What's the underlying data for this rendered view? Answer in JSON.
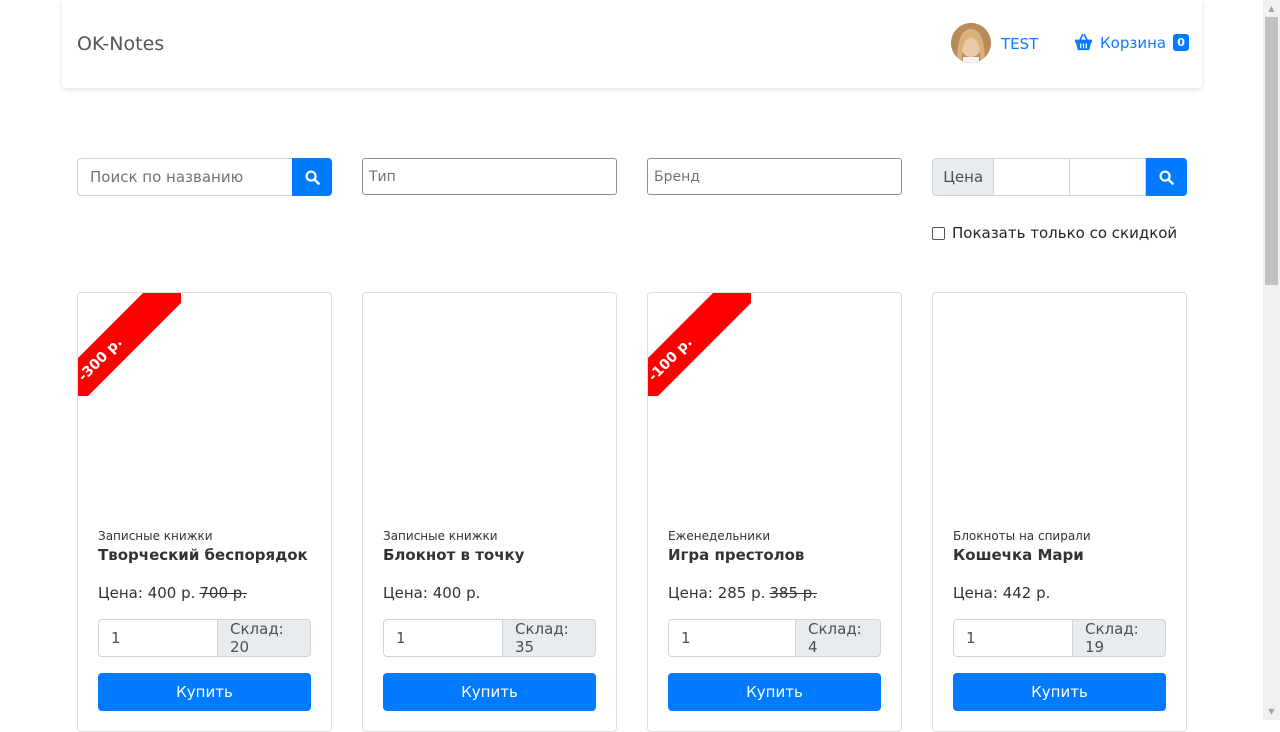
{
  "navbar": {
    "brand": "OK-Notes",
    "user": "TEST",
    "cart_label": "Корзина",
    "cart_count": "0"
  },
  "filters": {
    "search_placeholder": "Поиск по названию",
    "type_placeholder": "Тип",
    "brand_placeholder": "Бренд",
    "price_label": "Цена",
    "discount_label": "Показать только со скидкой"
  },
  "products": [
    {
      "discount": "-300 р.",
      "category": "Записные книжки",
      "title": "Творческий беспорядок",
      "price_prefix": "Цена: 400 р.",
      "old_price": "700 р.",
      "qty": "1",
      "stock": "Склад: 20",
      "buy": "Купить"
    },
    {
      "discount": "",
      "category": "Записные книжки",
      "title": "Блокнот в точку",
      "price_prefix": "Цена: 400 р.",
      "old_price": "",
      "qty": "1",
      "stock": "Склад: 35",
      "buy": "Купить"
    },
    {
      "discount": "-100 р.",
      "category": "Еженедельники",
      "title": "Игра престолов",
      "price_prefix": "Цена: 285 р.",
      "old_price": "385 р.",
      "qty": "1",
      "stock": "Склад: 4",
      "buy": "Купить"
    },
    {
      "discount": "",
      "category": "Блокноты на спирали",
      "title": "Кошечка Мари",
      "price_prefix": "Цена: 442 р.",
      "old_price": "",
      "qty": "1",
      "stock": "Склад: 19",
      "buy": "Купить"
    }
  ],
  "colors": {
    "primary": "#007bff",
    "ribbon": "#ff0000",
    "link": "#0d7bff"
  }
}
